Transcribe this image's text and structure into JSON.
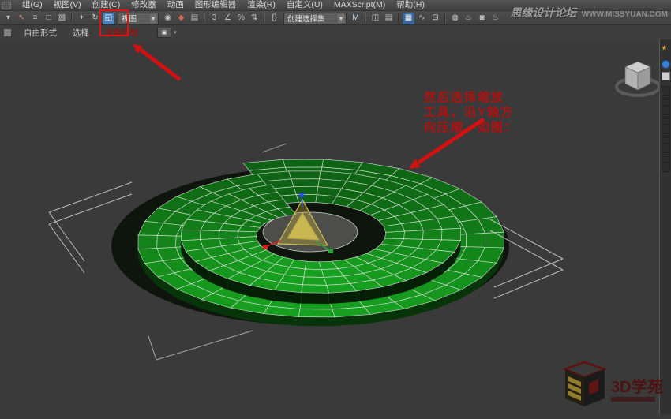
{
  "header": {
    "menu_items": [
      "组(G)",
      "视图(V)",
      "创建(C)",
      "修改器",
      "动画",
      "图形编辑器",
      "渲染(R)",
      "自定义(U)",
      "MAXScript(M)",
      "帮助(H)"
    ],
    "site_watermark": {
      "name": "思缘设计论坛",
      "url": "WWW.MISSYUAN.COM"
    }
  },
  "toolbar": {
    "items": [
      {
        "type": "icon",
        "name": "selection-filter-caret",
        "glyph": "▾"
      },
      {
        "type": "icon",
        "name": "select-object-icon",
        "glyph": "↖",
        "fg": "#d09080"
      },
      {
        "type": "icon",
        "name": "select-by-name-icon",
        "glyph": "≡"
      },
      {
        "type": "icon",
        "name": "rectangular-region-icon",
        "glyph": "□"
      },
      {
        "type": "icon",
        "name": "window-crossing-icon",
        "glyph": "▧"
      },
      {
        "type": "sep"
      },
      {
        "type": "icon",
        "name": "select-move-icon",
        "glyph": "+",
        "fg": "#dddddd"
      },
      {
        "type": "icon",
        "name": "select-rotate-icon",
        "glyph": "↻"
      },
      {
        "type": "icon",
        "name": "select-scale-icon",
        "glyph": "◱",
        "highlight": true
      },
      {
        "type": "combo",
        "name": "reference-coordinate-combo",
        "value": "视图",
        "w": 44
      },
      {
        "type": "icon",
        "name": "use-pivot-center-icon",
        "glyph": "◉"
      },
      {
        "type": "icon",
        "name": "select-manipulate-icon",
        "glyph": "◆",
        "fg": "#cc6a55"
      },
      {
        "type": "icon",
        "name": "keyboard-override-icon",
        "glyph": "▤"
      },
      {
        "type": "sep"
      },
      {
        "type": "icon",
        "name": "snap-3d-icon",
        "glyph": "3"
      },
      {
        "type": "icon",
        "name": "angle-snap-icon",
        "glyph": "∠"
      },
      {
        "type": "icon",
        "name": "percent-snap-icon",
        "glyph": "%"
      },
      {
        "type": "icon",
        "name": "spinner-snap-icon",
        "glyph": "⇅"
      },
      {
        "type": "sep"
      },
      {
        "type": "icon",
        "name": "named-sets-edit-icon",
        "glyph": "{}"
      },
      {
        "type": "combo",
        "name": "named-selection-set-combo",
        "value": "创建选择集",
        "w": 72
      },
      {
        "type": "icon",
        "name": "mirror-icon",
        "glyph": "M",
        "fg": "#bcd6ee"
      },
      {
        "type": "sep"
      },
      {
        "type": "icon",
        "name": "align-icon",
        "glyph": "◫"
      },
      {
        "type": "icon",
        "name": "layer-manager-icon",
        "glyph": "▤"
      },
      {
        "type": "sep"
      },
      {
        "type": "icon",
        "name": "graphite-toggle-icon",
        "glyph": "▦",
        "bg": "#38679c",
        "fg": "#ffffff"
      },
      {
        "type": "icon",
        "name": "curve-editor-icon",
        "glyph": "∿"
      },
      {
        "type": "icon",
        "name": "schematic-view-icon",
        "glyph": "⊟"
      },
      {
        "type": "sep"
      },
      {
        "type": "icon",
        "name": "material-editor-icon",
        "glyph": "◍"
      },
      {
        "type": "icon",
        "name": "render-setup-icon",
        "glyph": "♨"
      },
      {
        "type": "icon",
        "name": "rendered-frame-icon",
        "glyph": "◙"
      },
      {
        "type": "icon",
        "name": "render-production-icon",
        "glyph": "♨"
      }
    ]
  },
  "ribbon": {
    "tabs": [
      {
        "label": "自由形式"
      },
      {
        "label": "选择"
      },
      {
        "label": "对象绘制",
        "accent": true
      }
    ]
  },
  "annotation": {
    "tool_callout_lines": [
      "然后选择缩放",
      "工具，沿Y轴方",
      "向压缩，如图："
    ]
  },
  "brand": {
    "logo_text": "3D学苑"
  },
  "colors": {
    "accent_red": "#cf1111",
    "green_base": "#13961d",
    "green_side_outer": "#073509",
    "green_side_inner": "#041f06",
    "wire": "#d9e4d9",
    "bracket": "#cdcdcd",
    "gizmo_yellow": "#cdc04e",
    "axis_x": "#d02020",
    "axis_y": "#28a838",
    "axis_z": "#2b50e0"
  }
}
